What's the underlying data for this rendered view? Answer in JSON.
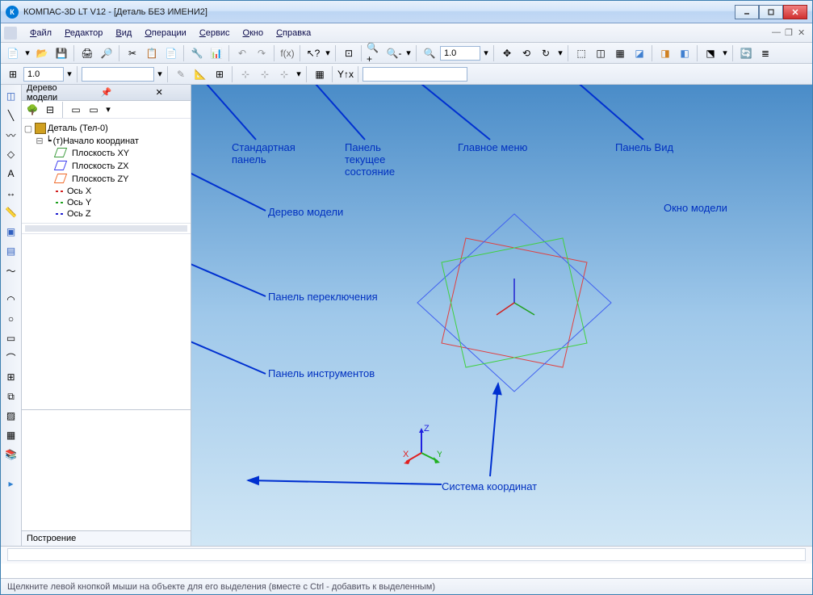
{
  "title": "КОМПАС-3D LT V12 - [Деталь БЕЗ ИМЕНИ2]",
  "menu": {
    "items": [
      "Файл",
      "Редактор",
      "Вид",
      "Операции",
      "Сервис",
      "Окно",
      "Справка"
    ]
  },
  "toolbar1": {
    "zoom_value": "1.0"
  },
  "toolbar2": {
    "scale_value": "1.0"
  },
  "tree": {
    "title": "Дерево модели",
    "root": "Деталь (Тел-0)",
    "origin": "(т)Начало координат",
    "planes": [
      "Плоскость XY",
      "Плоскость ZX",
      "Плоскость ZY"
    ],
    "axes": [
      "Ось X",
      "Ось Y",
      "Ось Z"
    ],
    "footer": "Построение"
  },
  "annotations": {
    "std_panel": "Стандартная\nпанель",
    "state_panel": "Панель\nтекущее\nсостояние",
    "main_menu": "Главное меню",
    "view_panel": "Панель Вид",
    "model_tree": "Дерево модели",
    "model_window": "Окно модели",
    "switch_panel": "Панель переключения",
    "tool_panel": "Панель инструментов",
    "coord_sys": "Система координат"
  },
  "gizmo": {
    "x": "X",
    "y": "Y",
    "z": "Z"
  },
  "status": "Щелкните левой кнопкой мыши на объекте для его выделения (вместе с Ctrl - добавить к выделенным)"
}
